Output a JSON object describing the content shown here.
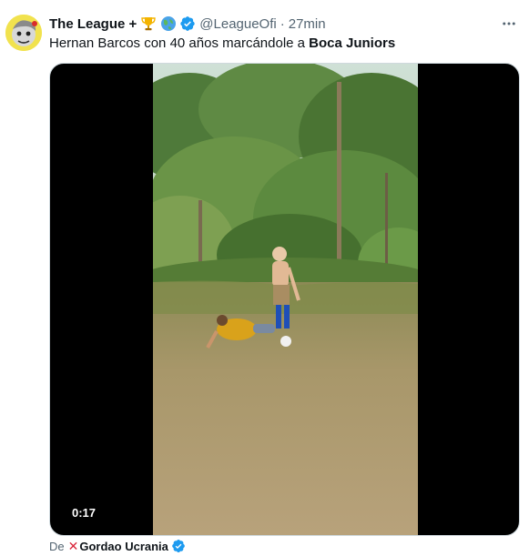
{
  "tweet": {
    "display_name": "The League +",
    "name_emojis": [
      "trophy-emoji",
      "globe-emoji"
    ],
    "handle": "@LeagueOfi",
    "separator": "·",
    "time": "27min",
    "text_plain": "Hernan Barcos con 40 años marcándole a ",
    "text_bold": "Boca Juniors",
    "more_label": "···"
  },
  "video": {
    "duration": "0:17"
  },
  "attribution": {
    "prefix": "De",
    "x_mark": "✕",
    "source": "Gordao Ucrania"
  },
  "colors": {
    "verified": "#1d9bf0",
    "secondary_text": "#536471",
    "primary_text": "#0f1419",
    "x_mark": "#d9263b"
  },
  "icons": {
    "verified": "verified-badge-icon",
    "more": "more-horizontal-icon"
  }
}
